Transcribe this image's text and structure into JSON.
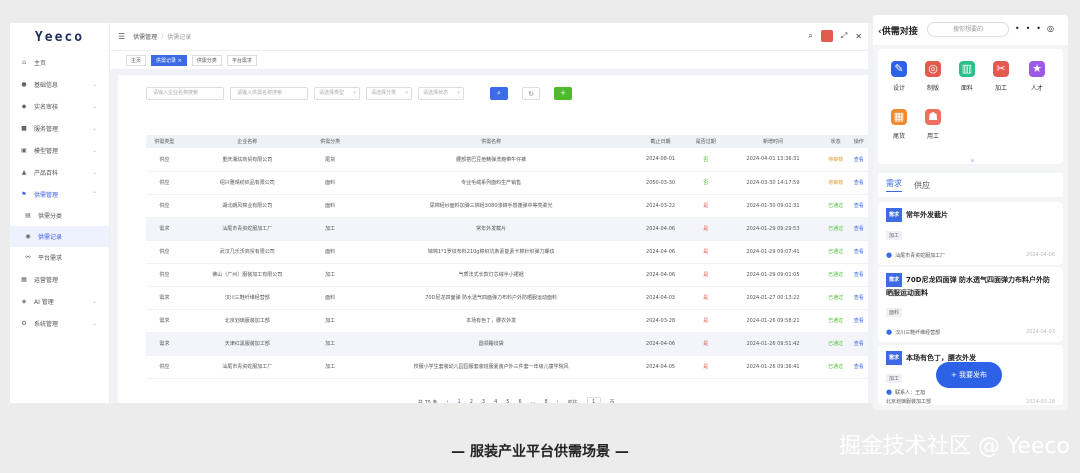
{
  "sidebar": {
    "logo": "Yeeco",
    "items": [
      {
        "label": "主页",
        "icon": "home-icon",
        "glyph": "⌂"
      },
      {
        "label": "基础信息",
        "icon": "person-icon",
        "glyph": "●"
      },
      {
        "label": "实名审核",
        "icon": "shield-icon",
        "glyph": "◆"
      },
      {
        "label": "服务管理",
        "icon": "briefcase-icon",
        "glyph": "■"
      },
      {
        "label": "模型管理",
        "icon": "box-icon",
        "glyph": "▣"
      },
      {
        "label": "产品百科",
        "icon": "cart-icon",
        "glyph": "▲"
      },
      {
        "label": "供需管理",
        "icon": "flag-icon",
        "glyph": "⚑"
      }
    ],
    "sub_items": [
      {
        "label": "供需分类",
        "icon": "category-icon",
        "glyph": "▤"
      },
      {
        "label": "供需记录",
        "icon": "record-icon",
        "glyph": "◉"
      },
      {
        "label": "平台需求",
        "icon": "link-icon",
        "glyph": "⚯"
      }
    ],
    "lower_items": [
      {
        "label": "运营管理",
        "icon": "grid-icon",
        "glyph": "▦"
      },
      {
        "label": "AI 管理",
        "icon": "robot-icon",
        "glyph": "◈"
      },
      {
        "label": "系统管理",
        "icon": "gear-icon",
        "glyph": "⚙"
      }
    ]
  },
  "topbar": {
    "crumb1": "供需管理",
    "crumb2": "供需记录",
    "tags": [
      "主页",
      "供需记录 ×",
      "供需分类",
      "平台需求"
    ]
  },
  "filters": {
    "input1": "请输入企业名称搜索",
    "input2": "请输入供需名称搜索",
    "sel1": "请选择类型",
    "sel2": "请选择分类",
    "sel3": "请选择状态"
  },
  "table": {
    "headers": [
      "供需类型",
      "企业名称",
      "供需分类",
      "供需名称",
      "截止日期",
      "是否过期",
      "新增时间",
      "状态",
      "操作"
    ],
    "rows": [
      {
        "type": "供应",
        "company": "重庆湘炫商贸有限公司",
        "cat": "尾货",
        "name": "腰部搭巴豆痘精弹洗瘾带牛仔裤",
        "due": "2024-08-01",
        "expired": "否",
        "created": "2024-04-01 13:36:31",
        "status": "待审核",
        "op": "查看"
      },
      {
        "type": "供应",
        "company": "绍兴雅晴纺织品有限公司",
        "cat": "面料",
        "name": "专业毛绒系列面料生产销售",
        "due": "2050-03-30",
        "expired": "否",
        "created": "2024-03-30 14:17:59",
        "status": "待审核",
        "op": "查看"
      },
      {
        "type": "供应",
        "company": "湖北朗风棉业有限公司",
        "cat": "面料",
        "name": "尿棉经纱面料加弹三棉经3080涤锦手感蓬弹中等亮柔光",
        "due": "2024-03-22",
        "expired": "是",
        "created": "2024-01-30 09:01:31",
        "status": "已通过",
        "op": "查看"
      },
      {
        "type": "需求",
        "company": "汕尾市青资蛇服加工厂",
        "cat": "加工",
        "name": "常年外发截片",
        "due": "2024-04-06",
        "expired": "是",
        "created": "2024-01-29 09:29:53",
        "status": "已通过",
        "op": "查看"
      },
      {
        "type": "供应",
        "company": "武汉几乐沃商贸有限公司",
        "cat": "面料",
        "name": "锦棉1*1罗纹布料210g棉织坑条素能素卡棉针织弹力螺纹",
        "due": "2024-04-06",
        "expired": "是",
        "created": "2024-01-29 09:07:41",
        "status": "已通过",
        "op": "查看"
      },
      {
        "type": "供应",
        "company": "佛山（广州）服装加工有限公司",
        "cat": "加工",
        "name": "气质法式长款灯芯绒半小裙裾",
        "due": "2024-04-06",
        "expired": "是",
        "created": "2024-01-29 09:01:05",
        "status": "已通过",
        "op": "查看"
      },
      {
        "type": "需求",
        "company": "汉川三鞋纤维经营部",
        "cat": "面料",
        "name": "70D尼龙四面弹 防水透气四面弹力布料户外防晒服运动面料",
        "due": "2024-04-03",
        "expired": "是",
        "created": "2024-01-27 00:13:22",
        "status": "已通过",
        "op": "查看"
      },
      {
        "type": "需求",
        "company": "北京划璃服装加工部",
        "cat": "加工",
        "name": "本场有色丁，腰衣外发",
        "due": "2024-03-28",
        "expired": "是",
        "created": "2024-01-26 09:58:21",
        "status": "已通过",
        "op": "查看"
      },
      {
        "type": "需求",
        "company": "天津红黑服装加工部",
        "cat": "加工",
        "name": "圆领睡纹袋",
        "due": "2024-04-06",
        "expired": "是",
        "created": "2024-01-26 09:51:42",
        "status": "已通过",
        "op": "查看"
      },
      {
        "type": "供应",
        "company": "汕尾市青资蛇服加工厂",
        "cat": "加工",
        "name": "校服小学生套装幼儿园园服套装班服夏装户外三件套一年级儿童学院风",
        "due": "2024-04-05",
        "expired": "是",
        "created": "2024-01-26 09:36:41",
        "status": "已通过",
        "op": "查看"
      }
    ]
  },
  "pager": {
    "total": "共 75 条",
    "pages": [
      "1",
      "2",
      "3",
      "4",
      "5",
      "6",
      "...",
      "8"
    ],
    "goto_label": "前往",
    "goto_value": "1",
    "page_unit": "页"
  },
  "phone": {
    "title": "供需对接",
    "search": "搜你想要的",
    "categories": [
      {
        "label": "设计",
        "icon": "design-icon",
        "color": "#2d62e6",
        "glyph": "✎"
      },
      {
        "label": "制版",
        "icon": "pattern-icon",
        "color": "#e35a4e",
        "glyph": "◎"
      },
      {
        "label": "面料",
        "icon": "fabric-icon",
        "color": "#2bbf8a",
        "glyph": "▥"
      },
      {
        "label": "加工",
        "icon": "processing-icon",
        "color": "#e35a4e",
        "glyph": "✂"
      },
      {
        "label": "人才",
        "icon": "talent-icon",
        "color": "#9b59e6",
        "glyph": "★"
      },
      {
        "label": "尾货",
        "icon": "stock-icon",
        "color": "#f08a30",
        "glyph": "▦"
      },
      {
        "label": "用工",
        "icon": "labor-icon",
        "color": "#f07060",
        "glyph": "☗"
      }
    ],
    "tab_demand": "需求",
    "tab_supply": "供应",
    "cards": [
      {
        "badge": "需求",
        "title": "常年外发截片",
        "tag": "加工",
        "company": "汕尾市青资蛇服加工厂",
        "date": "2024-04-06"
      },
      {
        "badge": "需求",
        "title": "70D尼龙四面弹 防水透气四面弹力布料户外防晒服运动面料",
        "tag": "面料",
        "company": "汉川三鞋纤维经营部",
        "date": "2024-04-03"
      },
      {
        "badge": "需求",
        "title": "本场有色丁，腰衣外发",
        "tag": "加工",
        "contact": "联系人：王旭",
        "company": "北京划璃服装加工部",
        "date": "2024-03-28"
      }
    ],
    "fab": "+ 我要发布"
  },
  "caption": "— 服装产业平台供需场景 —",
  "watermark": "掘金技术社区 @ Yeeco",
  "colors": {
    "accent": "#3d6be6",
    "green": "#4cbb2c",
    "red": "#e35a4e",
    "orange": "#e39a2c"
  }
}
